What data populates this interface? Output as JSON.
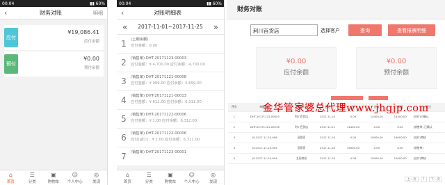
{
  "phone1": {
    "status_time": "00:04",
    "status_right": "▮▮ 60%",
    "nav_title": "财务对账",
    "nav_right": "明细",
    "payable": {
      "badge": "应付",
      "amount": "¥19,086.41",
      "caption": "应付余额"
    },
    "prepaid": {
      "badge": "预付",
      "amount": "¥0.00",
      "caption": "预付余额"
    },
    "tabs": [
      "首页",
      "分类",
      "购物车",
      "个人中心",
      "发现"
    ]
  },
  "phone2": {
    "status_time": "00:04",
    "status_right": "▮▮ 60%",
    "nav_title": "对账明细表",
    "date_range": "2017-11-01~2017-11-25",
    "items": [
      {
        "num": "1",
        "line1": "(上期余额)",
        "line2": "应付金额：0.00"
      },
      {
        "num": "2",
        "line1": "(销售单) DHT-20171123-00003",
        "line2": "应付金额：¥ 4,700.00  应付余额：4,700.00"
      },
      {
        "num": "3",
        "line1": "(销售单) DHT-20171121-00008",
        "line2": "应付金额：¥ 999.00  应付余额：5,699.00"
      },
      {
        "num": "4",
        "line1": "(销售单) DHT-20171121-00013",
        "line2": "应付金额：¥ 612.00  应付余额：6,311.00"
      },
      {
        "num": "5",
        "line1": "(销售单) DHT-20171122-00006",
        "line2": "应付金额：¥ 1.00  应付余额：6,312.00"
      },
      {
        "num": "6",
        "line1": "(销售单) DHT-20171122-00006",
        "line2": "应付(减少)：¥ 1.00  应付余额：6,311.00"
      },
      {
        "num": "7",
        "line1": "(销售单) DHT-20171123-00001",
        "line2": ""
      }
    ],
    "tabs": [
      "首页",
      "分类",
      "购物车",
      "个人中心",
      "发现"
    ]
  },
  "desktop": {
    "title": "财务对账",
    "customer_value": "利川百货店",
    "select_customer_label": "选择客户",
    "query_button": "查询",
    "view_detail_button": "查看报表明细",
    "payable_amount": "¥0.00",
    "payable_caption": "应付余额",
    "prepaid_amount": "¥0.00",
    "prepaid_caption": "预付余额",
    "table_headers": [
      "序号",
      "单据编号",
      "往来单位",
      "日期",
      "应付",
      "应收",
      "余额",
      "备注"
    ],
    "table_rows": [
      [
        "1",
        "DHT-20171123-00003",
        "利川百货店",
        "2017-11-23",
        "0.00",
        "14400.00",
        "14400.00",
        "(应付)已确认"
      ],
      [
        "2",
        "DHT-20171121-00016",
        "利川百货店",
        "2017-11-21",
        "14400.00",
        "0.00",
        "0.00",
        "(销售单) 已确认"
      ],
      [
        "3",
        "JS-2017-11-20-006",
        "丽思家",
        "2017-11-20",
        "0.00",
        "19000.00",
        "19000.00",
        "(应付)审核"
      ],
      [
        "4",
        "JS-2017-11-20-005",
        "丽思家",
        "2017-11-20",
        "19000.00",
        "0.00",
        "0.00",
        "(销售单)"
      ],
      [
        "5",
        "JS-2017-11-20-004",
        "五彩缤纷",
        "2017-11-20",
        "0.00",
        "15000.00",
        "15000.00",
        "(应付)审核"
      ]
    ],
    "pager": [
      "上一页",
      "1",
      "下一页"
    ]
  },
  "watermark": "金华管家婆总代理www.jhgjp.com",
  "colors": {
    "accent": "#f0776c",
    "payable_badge": "#4fc6d8",
    "prepaid_badge": "#5cb87a",
    "watermark": "#e40000"
  }
}
